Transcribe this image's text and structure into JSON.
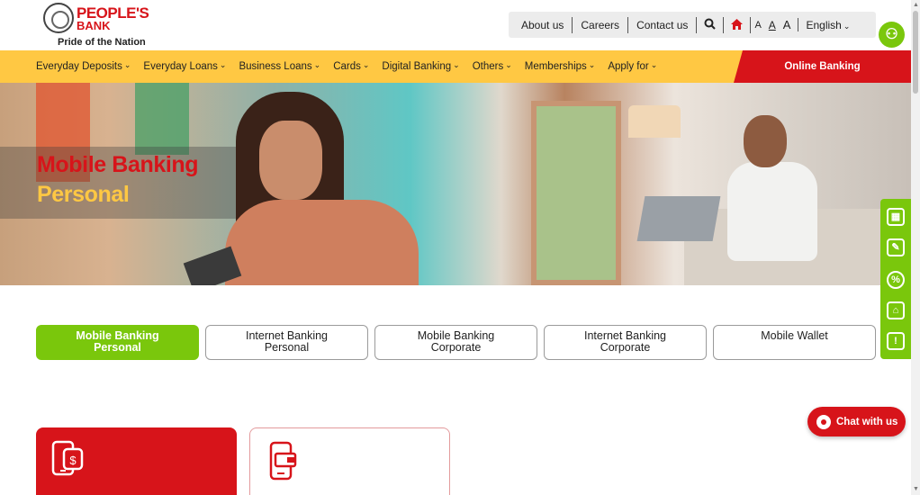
{
  "header": {
    "logo_name_line1": "PEOPLE'S",
    "logo_name_line2": "BANK",
    "logo_tagline": "Pride of the Nation",
    "links": [
      "About us",
      "Careers",
      "Contact us"
    ],
    "text_size_labels": [
      "A",
      "A",
      "A"
    ],
    "language": "English",
    "search_icon": "search-icon",
    "home_icon": "home-icon",
    "accessibility_icon": "accessibility-icon"
  },
  "nav": {
    "items": [
      "Everyday Deposits",
      "Everyday Loans",
      "Business Loans",
      "Cards",
      "Digital Banking",
      "Others",
      "Memberships",
      "Apply for"
    ],
    "online_banking": "Online Banking"
  },
  "hero": {
    "title_line1": "Mobile Banking",
    "title_line2": "Personal"
  },
  "tabs": [
    {
      "label": "Mobile Banking Personal",
      "line1": "Mobile Banking",
      "line2": "Personal",
      "active": true
    },
    {
      "label": "Internet Banking Personal",
      "line1": "Internet Banking",
      "line2": "Personal",
      "active": false
    },
    {
      "label": "Mobile Banking Corporate",
      "line1": "Mobile Banking",
      "line2": "Corporate",
      "active": false
    },
    {
      "label": "Internet Banking Corporate",
      "line1": "Internet Banking",
      "line2": "Corporate",
      "active": false
    },
    {
      "label": "Mobile Wallet",
      "line1": "Mobile Wallet",
      "line2": "",
      "active": false
    }
  ],
  "side_tools": [
    "calculator-icon",
    "apply-form-icon",
    "percentage-icon",
    "branch-icon",
    "feedback-icon"
  ],
  "chat": {
    "label": "Chat with us"
  },
  "cards": [
    {
      "icon": "mobile-payment-icon"
    },
    {
      "icon": "mobile-wallet-icon"
    }
  ],
  "colors": {
    "brand_red": "#d7141a",
    "brand_yellow": "#ffc843",
    "accent_green": "#7ac70c"
  }
}
